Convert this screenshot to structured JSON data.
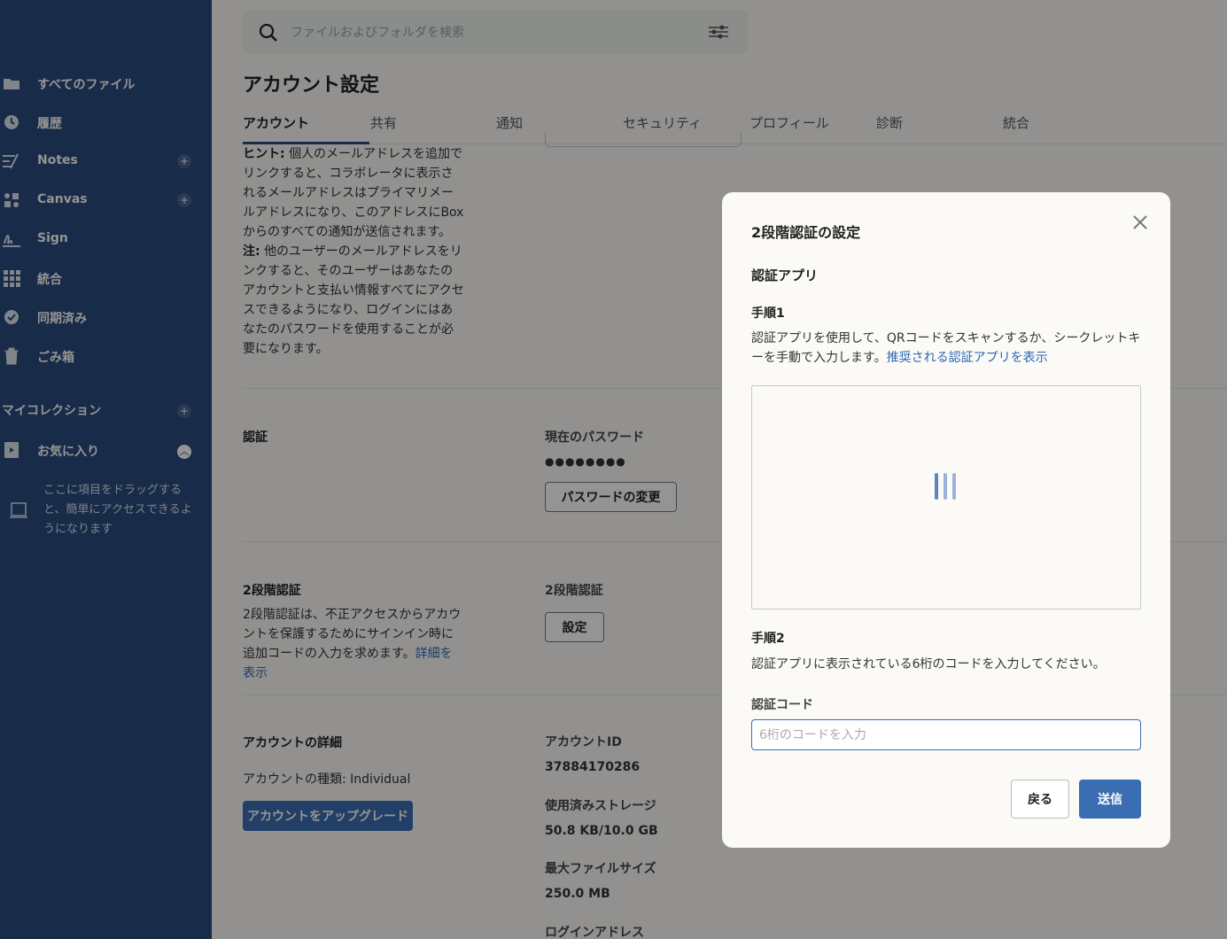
{
  "sidebar": {
    "items": [
      {
        "label": "すべてのファイル",
        "icon": "folder-icon"
      },
      {
        "label": "履歴",
        "icon": "clock-icon"
      },
      {
        "label": "Notes",
        "icon": "notes-icon"
      },
      {
        "label": "Canvas",
        "icon": "canvas-icon"
      },
      {
        "label": "Sign",
        "icon": "sign-icon"
      },
      {
        "label": "統合",
        "icon": "grid-icon"
      },
      {
        "label": "同期済み",
        "icon": "sync-icon"
      },
      {
        "label": "ごみ箱",
        "icon": "trash-icon"
      }
    ],
    "collections_title": "マイコレクション",
    "favorites_label": "お気に入り",
    "drag_hint": "ここに項目をドラッグすると、簡単にアクセスできるようになります"
  },
  "search": {
    "placeholder": "ファイルおよびフォルダを検索"
  },
  "page": {
    "title": "アカウント設定",
    "tabs": [
      "アカウント",
      "共有",
      "通知",
      "セキュリティ",
      "プロフィール",
      "診断",
      "統合"
    ],
    "hint_bold": "ヒント:",
    "hint_text": "個人のメールアドレスを追加でリンクすると、コラボレータに表示されるメールアドレスはプライマリメールアドレスになり、このアドレスにBoxからのすべての通知が送信されます。",
    "hint_note_bold": "注:",
    "hint_note_text": "他のユーザーのメールアドレスをリンクすると、そのユーザーはあなたのアカウントと支払い情報すべてにアクセスできるようになり、ログインにはあなたのパスワードを使用することが必要になります。",
    "auth": {
      "label": "認証",
      "current_password_label": "現在のパスワード",
      "password_mask": "●●●●●●●●",
      "change_password_button": "パスワードの変更"
    },
    "two_factor": {
      "label": "2段階認証",
      "description": "2段階認証は、不正アクセスからアカウントを保護するためにサインイン時に追加コードの入力を求めます。",
      "learn_more": "詳細を表示",
      "field_label": "2段階認証",
      "setup_button": "設定"
    },
    "account_details": {
      "label": "アカウントの詳細",
      "type_text": "アカウントの種類: Individual",
      "upgrade_button": "アカウントをアップグレード",
      "id_label": "アカウントID",
      "id_value": "37884170286",
      "storage_label": "使用済みストレージ",
      "storage_value": "50.8 KB/10.0 GB",
      "max_file_label": "最大ファイルサイズ",
      "max_file_value": "250.0 MB",
      "login_label": "ログインアドレス"
    }
  },
  "modal": {
    "title": "2段階認証の設定",
    "subtitle": "認証アプリ",
    "step1_label": "手順1",
    "step1_text": "認証アプリを使用して、QRコードをスキャンするか、シークレットキーを手動で入力します。",
    "step1_link": "推奨される認証アプリを表示",
    "step2_label": "手順2",
    "step2_text": "認証アプリに表示されている6桁のコードを入力してください。",
    "code_label": "認証コード",
    "code_placeholder": "6桁のコードを入力",
    "code_value": "",
    "back_button": "戻る",
    "submit_button": "送信"
  },
  "colors": {
    "sidebar_bg": "#2a4a7e",
    "accent": "#3b6db2",
    "link": "#2f66b3"
  }
}
